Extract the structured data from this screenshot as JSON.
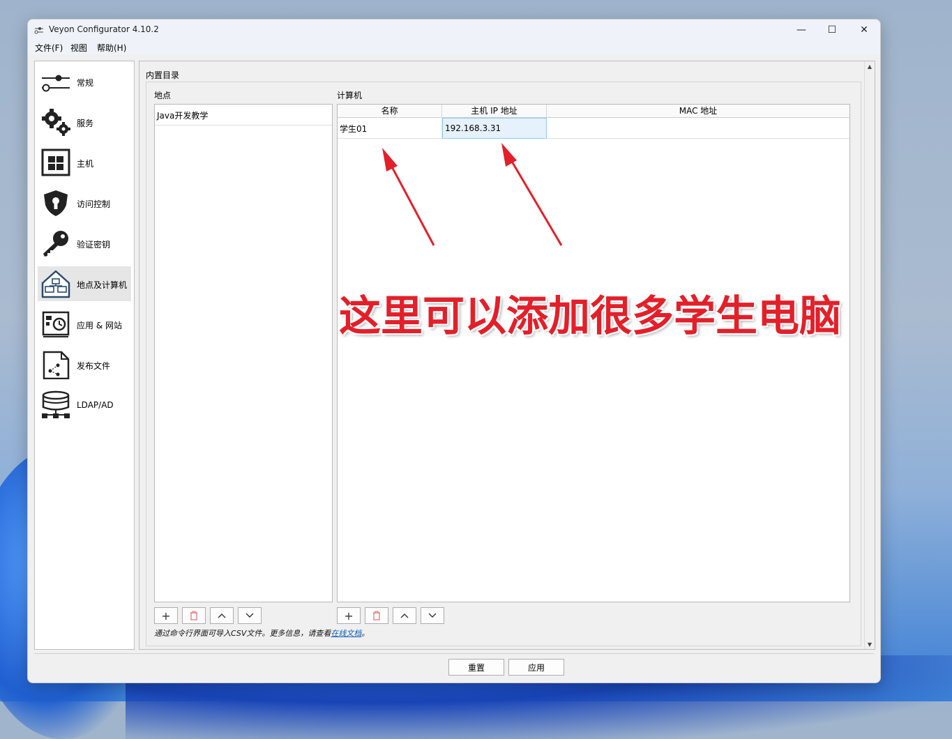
{
  "window": {
    "title": "Veyon Configurator 4.10.2",
    "minimize_glyph": "—",
    "maximize_glyph": "☐",
    "close_glyph": "✕"
  },
  "menu": {
    "file": "文件(F)",
    "view": "视图",
    "help": "帮助(H)"
  },
  "sidebar": {
    "items": [
      {
        "label": "常规",
        "icon": "slider-icon"
      },
      {
        "label": "服务",
        "icon": "gears-icon"
      },
      {
        "label": "主机",
        "icon": "grid-window-icon"
      },
      {
        "label": "访问控制",
        "icon": "shield-keyhole-icon"
      },
      {
        "label": "验证密钥",
        "icon": "key-icon"
      },
      {
        "label": "地点及计算机",
        "icon": "house-computers-icon"
      },
      {
        "label": "应用 & 网站",
        "icon": "app-window-clock-icon"
      },
      {
        "label": "发布文件",
        "icon": "document-share-icon"
      },
      {
        "label": "LDAP/AD",
        "icon": "database-network-icon"
      }
    ],
    "active_index": 5
  },
  "main": {
    "section_title": "内置目录",
    "locations": {
      "label": "地点",
      "rows": [
        "Java开发教学"
      ]
    },
    "computers": {
      "label": "计算机",
      "columns": [
        "名称",
        "主机 IP 地址",
        "MAC 地址"
      ],
      "rows": [
        {
          "name": "学生01",
          "ip": "192.168.3.31",
          "mac": ""
        }
      ]
    },
    "toolbar_glyphs": {
      "add": "+",
      "remove": "🗑",
      "up": "⌃",
      "down": "⌄"
    },
    "hint_text": "通过命令行界面可导入CSV文件。更多信息，请查看",
    "hint_link": "在线文档",
    "hint_end": "。"
  },
  "footer": {
    "reset": "重置",
    "apply": "应用"
  },
  "annotation": {
    "text": "这里可以添加很多学生电脑",
    "color": "#e3202a"
  }
}
